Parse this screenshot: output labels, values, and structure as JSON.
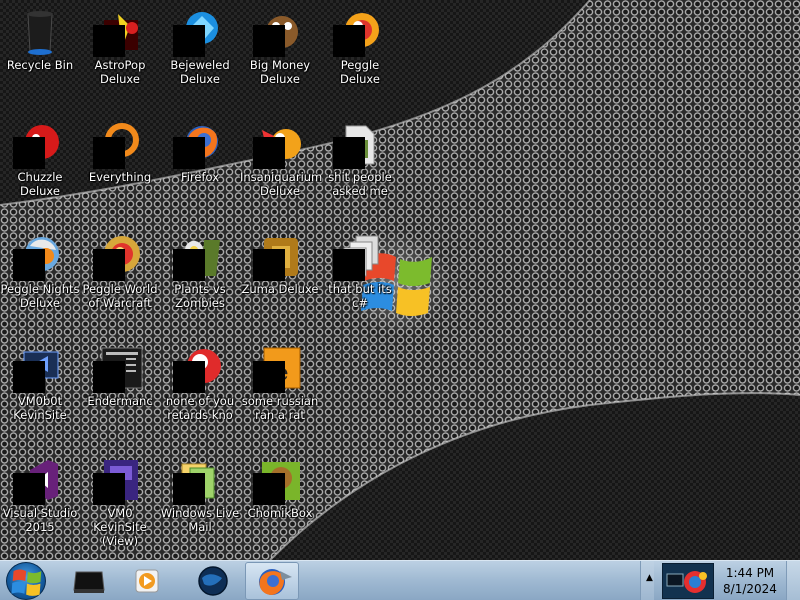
{
  "desktop": {
    "icons": [
      {
        "label": "Recycle Bin",
        "icon": "recycle-bin-icon"
      },
      {
        "label": "Chuzzle\nDeluxe",
        "icon": "chuzzle-icon"
      },
      {
        "label": "Peggle Nights\nDeluxe",
        "icon": "peggle-nights-icon"
      },
      {
        "label": "VM0b0t\nKevinSite",
        "icon": "vm-shortcut-icon"
      },
      {
        "label": "Visual Studio\n2015",
        "icon": "visual-studio-icon"
      },
      {
        "label": "AstroPop\nDeluxe",
        "icon": "astropop-icon"
      },
      {
        "label": "Everything",
        "icon": "everything-search-icon"
      },
      {
        "label": "Peggle World\nof Warcraft",
        "icon": "peggle-wow-icon"
      },
      {
        "label": "Endermanc",
        "icon": "terminal-icon"
      },
      {
        "label": "VM0 KevinSite\n(View)",
        "icon": "vm-view-icon"
      },
      {
        "label": "Bejeweled\nDeluxe",
        "icon": "bejeweled-icon"
      },
      {
        "label": "Firefox",
        "icon": "firefox-icon"
      },
      {
        "label": "Plants vs\nZombies",
        "icon": "plants-vs-zombies-icon"
      },
      {
        "label": "none of you\nretards kno",
        "icon": "pinball-icon"
      },
      {
        "label": "Windows Live\nMail",
        "icon": "windows-live-mail-icon"
      },
      {
        "label": "Big Money\nDeluxe",
        "icon": "big-money-icon"
      },
      {
        "label": "Insaniquarium\nDeluxe",
        "icon": "insaniquarium-icon"
      },
      {
        "label": "Zuma Deluxe",
        "icon": "zuma-icon"
      },
      {
        "label": "some russian\nran a rat",
        "icon": "orange-document-icon"
      },
      {
        "label": "ChomikBox",
        "icon": "chomikbox-icon"
      },
      {
        "label": "Peggle Deluxe",
        "icon": "peggle-icon"
      },
      {
        "label": "shit people\nasked me",
        "icon": "folder-icon"
      },
      {
        "label": "that but its c#",
        "icon": "stacked-files-icon"
      }
    ]
  },
  "taskbar": {
    "start": {
      "icon": "windows-start-orb-icon"
    },
    "pinned": [
      {
        "icon": "terminal-icon",
        "active": false
      },
      {
        "icon": "media-player-icon",
        "active": false
      },
      {
        "icon": "globe-icon",
        "active": false
      },
      {
        "icon": "firefox-icon",
        "active": true
      }
    ],
    "tray": {
      "show_hidden": "▲",
      "app_icon": "tray-app-icon"
    },
    "clock": {
      "time": "1:44 PM",
      "date": "8/1/2024"
    }
  },
  "colors": {
    "taskbar_top": "#bcd0e3",
    "taskbar_bottom": "#8aa7c4",
    "label_text": "#ffffff"
  }
}
